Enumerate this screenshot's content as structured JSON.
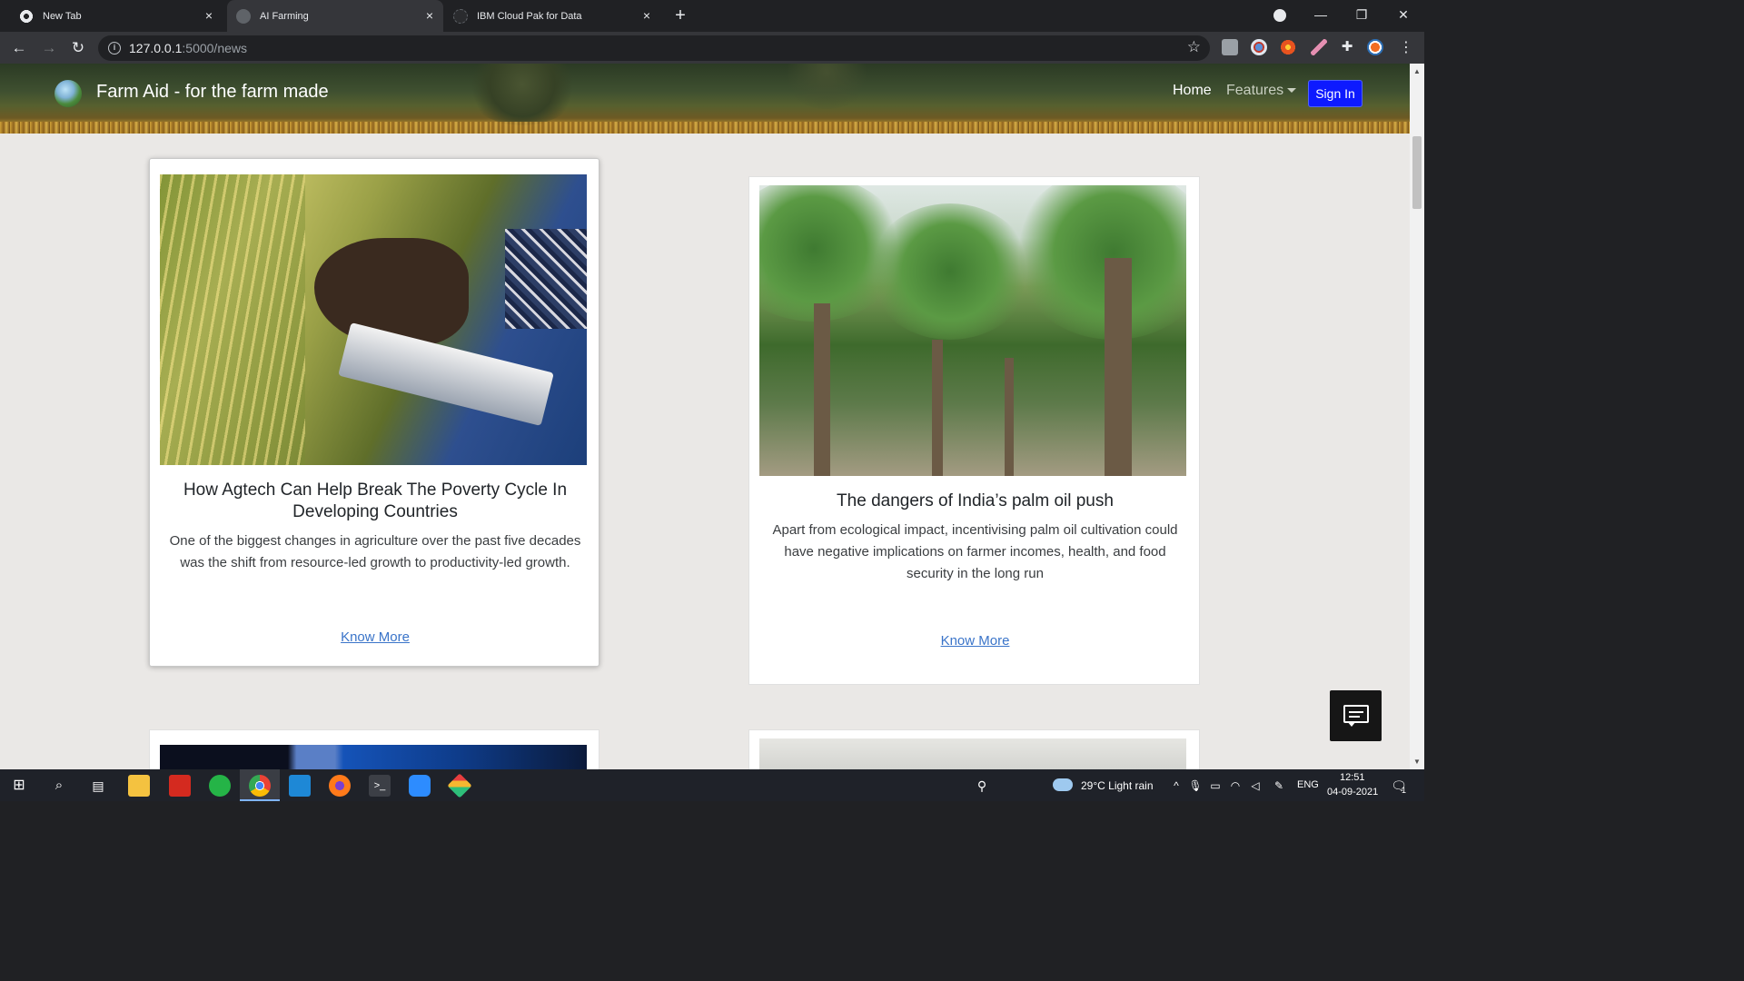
{
  "browser": {
    "tabs": [
      {
        "title": "New Tab",
        "active": false,
        "favicon_color": "#e8eaed"
      },
      {
        "title": "AI Farming",
        "active": true,
        "favicon_color": "#5f6368"
      },
      {
        "title": "IBM Cloud Pak for Data",
        "active": false,
        "favicon_color": "#202124"
      }
    ],
    "url_host": "127.0.0.1",
    "url_path": ":5000/news"
  },
  "site": {
    "brand": "Farm Aid - for the farm made",
    "nav": {
      "home": "Home",
      "features": "Features",
      "sign_in": "Sign In"
    }
  },
  "articles": [
    {
      "title": "How Agtech Can Help Break The Poverty Cycle In Developing Countries",
      "summary": "One of the biggest changes in agriculture over the past five decades was the shift from resource-led growth to productivity-led growth.",
      "link": "Know More",
      "image": "farmer-rice-tablet"
    },
    {
      "title": "The dangers of India’s palm oil push",
      "summary": "Apart from ecological impact, incentivising palm oil cultivation could have negative implications on farmer incomes, health, and food security in the long run",
      "link": "Know More",
      "image": "palm-plantation"
    }
  ],
  "taskbar": {
    "weather": "29°C  Light rain",
    "lang": "ENG",
    "time": "12:51",
    "date": "04-09-2021",
    "notifications": "1"
  },
  "colors": {
    "signin_bg": "#0d1aff",
    "link": "#3a74c9",
    "page_bg": "#eae8e6"
  }
}
